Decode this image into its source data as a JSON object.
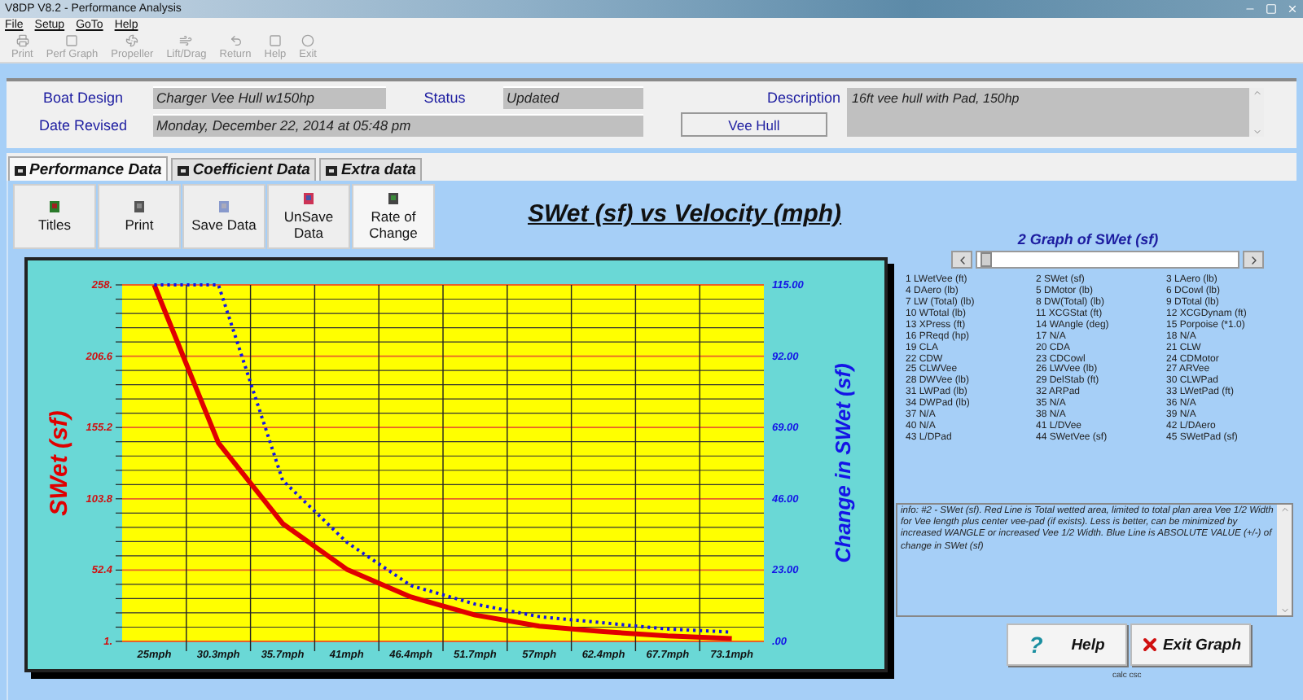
{
  "window": {
    "title": "V8DP V8.2 - Performance Analysis"
  },
  "menu": [
    "File",
    "Setup",
    "GoTo",
    "Help"
  ],
  "toolbar": [
    {
      "label": "Print",
      "disabled": true
    },
    {
      "label": "Perf Graph",
      "disabled": true
    },
    {
      "label": "Propeller",
      "disabled": true
    },
    {
      "label": "Lift/Drag",
      "disabled": true
    },
    {
      "label": "Return",
      "disabled": true
    },
    {
      "label": "Help",
      "disabled": true
    },
    {
      "label": "Exit",
      "disabled": true
    }
  ],
  "header": {
    "boat_design_label": "Boat Design",
    "boat_design": "Charger Vee Hull w150hp",
    "status_label": "Status",
    "status": "Updated",
    "date_label": "Date Revised",
    "date": "Monday, December 22, 2014 at 05:48 pm",
    "description_label": "Description",
    "description": "16ft vee hull with Pad, 150hp",
    "hull_button": "Vee Hull"
  },
  "tabs": [
    {
      "label": "Performance Data",
      "selected": true
    },
    {
      "label": "Coefficient Data",
      "selected": false
    },
    {
      "label": "Extra data",
      "selected": false
    }
  ],
  "graph_buttons": [
    {
      "label": "Titles"
    },
    {
      "label": "Print"
    },
    {
      "label": "Save Data"
    },
    {
      "label": "UnSave Data"
    },
    {
      "label": "Rate of Change"
    }
  ],
  "chart": {
    "chart_data": {
      "type": "line",
      "title": "SWet (sf) vs Velocity (mph)",
      "grid": true,
      "categories": [
        "25mph",
        "30.3mph",
        "35.7mph",
        "41mph",
        "46.4mph",
        "51.7mph",
        "57mph",
        "62.4mph",
        "67.7mph",
        "73.1mph"
      ],
      "ylim": [
        1,
        258
      ],
      "yticks": [
        {
          "value": 1,
          "label": "1."
        },
        {
          "value": 52.4,
          "label": "52.4"
        },
        {
          "value": 103.8,
          "label": "103.8"
        },
        {
          "value": 155.2,
          "label": "155.2"
        },
        {
          "value": 206.6,
          "label": "206.6"
        },
        {
          "value": 258,
          "label": "258."
        }
      ],
      "y2lim": [
        0,
        115
      ],
      "y2ticks": [
        {
          "value": 0,
          "label": ".00"
        },
        {
          "value": 23,
          "label": "23.00"
        },
        {
          "value": 46,
          "label": "46.00"
        },
        {
          "value": 69,
          "label": "69.00"
        },
        {
          "value": 92,
          "label": "92.00"
        },
        {
          "value": 115,
          "label": "115.00"
        }
      ],
      "series": [
        {
          "name": "SWet (sf)",
          "color": "#e00000",
          "line_style": "solid",
          "values": [
            258,
            144,
            86,
            53,
            33,
            20,
            12,
            8,
            5,
            3
          ]
        },
        {
          "name": "Change in SWet (sf)",
          "color": "#1414e6",
          "axis": "y2",
          "line_style": "dotted",
          "values": [
            115,
            115,
            52,
            32,
            18,
            12,
            8,
            6,
            4,
            3
          ]
        }
      ]
    }
  },
  "graph_selector": {
    "title": "2 Graph of SWet (sf)"
  },
  "variables": [
    "1 LWetVee (ft)",
    "2 SWet (sf)",
    "3 LAero (lb)",
    "4 DAero (lb)",
    "5 DMotor (lb)",
    "6 DCowl (lb)",
    "7 LW (Total) (lb)",
    "8 DW(Total) (lb)",
    "9 DTotal (lb)",
    "10 WTotal (lb)",
    "11 XCGStat (ft)",
    "12 XCGDynam (ft)",
    "13 XPress (ft)",
    "14 WAngle (deg)",
    "15 Porpoise (*1.0)",
    "16 PReqd (hp)",
    "17 N/A",
    "18 N/A",
    "19 CLA",
    "20 CDA",
    "21 CLW",
    "22 CDW",
    "23 CDCowl",
    "24 CDMotor",
    "25 CLWVee",
    "26 LWVee (lb)",
    "27 ARVee",
    "28 DWVee (lb)",
    "29 DelStab (ft)",
    "30 CLWPad",
    "31 LWPad (lb)",
    "32 ARPad",
    "33 LWetPad (ft)",
    "34 DWPad (lb)",
    "35 N/A",
    "36 N/A",
    "37 N/A",
    "38 N/A",
    "39 N/A",
    "40 N/A",
    "41 L/DVee",
    "42 L/DAero",
    "43 L/DPad",
    "44 SWetVee (sf)",
    "45 SWetPad (sf)"
  ],
  "info": "info: #2 - SWet (sf). Red Line is Total wetted area, limited to total plan area Vee 1/2 Width for Vee length plus center vee-pad (if exists). Less is better, can be minimized by increased WANGLE or increased Vee 1/2 Width. Blue Line is ABSOLUTE VALUE (+/-) of change in SWet (sf)",
  "help_button": {
    "icon": "?",
    "label": "Help"
  },
  "exit_button": {
    "label": "Exit Graph"
  },
  "footer_note": "calc csc"
}
